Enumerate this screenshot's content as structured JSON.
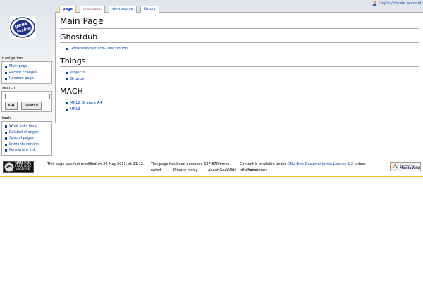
{
  "personal": {
    "login_label": "Log in / create account"
  },
  "logo": {
    "line1": "geek",
    "line2": "inside"
  },
  "tabs": [
    {
      "label": "page",
      "selected": true
    },
    {
      "label": "discussion",
      "selected": false
    },
    {
      "label": "view source",
      "selected": false
    },
    {
      "label": "history",
      "selected": false
    }
  ],
  "content": {
    "title": "Main Page",
    "sections": [
      {
        "heading": "Ghostdub",
        "links": [
          "Ghostdub/Service-Description"
        ]
      },
      {
        "heading": "Things",
        "links": [
          "Projects",
          "Gruppe"
        ]
      },
      {
        "heading": "MACH",
        "links": [
          "MKL2 Gruppe A4",
          "MKL3"
        ]
      }
    ]
  },
  "sidebar": {
    "navigation": {
      "heading": "navigation",
      "items": [
        "Main page",
        "Recent changes",
        "Random page"
      ]
    },
    "search": {
      "heading": "search",
      "input_value": "",
      "go_label": "Go",
      "search_label": "Search"
    },
    "tools": {
      "heading": "tools",
      "items": [
        "What links here",
        "Related changes",
        "Special pages",
        "Printable version",
        "Permanent link"
      ]
    }
  },
  "footer": {
    "gfdl": {
      "line1": "GNU FDL",
      "line2": "FREE DOC",
      "line3": "LICENSE"
    },
    "last_modified": "This page was last modified on 20 May 2013, at 11:12.",
    "view_count": "This page has been accessed 627,870 times.",
    "copyright_prefix": "Content is available under",
    "copyright_link": "GNU Free Documentation License 1.2",
    "copyright_suffix": "unless otherwise",
    "noted": "noted.",
    "links": [
      "Privacy policy",
      "About GeekWiki",
      "Disclaimers"
    ],
    "mediawiki": {
      "line1": "Powered by",
      "line2": "MediaWiki"
    }
  },
  "colors": {
    "link": "#0645ad",
    "footer_border": "#fabd23",
    "logo_blue": "#1c2f8c"
  }
}
